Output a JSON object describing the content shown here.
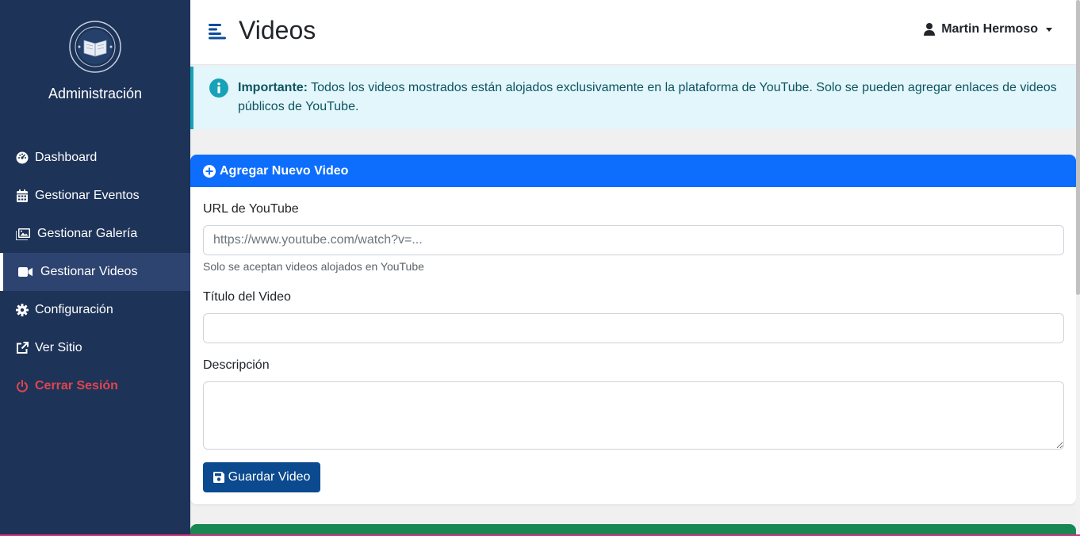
{
  "sidebar": {
    "brand": "Administración",
    "items": [
      {
        "label": "Dashboard",
        "icon": "dashboard-icon"
      },
      {
        "label": "Gestionar Eventos",
        "icon": "calendar-icon"
      },
      {
        "label": "Gestionar Galería",
        "icon": "image-icon"
      },
      {
        "label": "Gestionar Videos",
        "icon": "video-camera-icon",
        "active": true
      },
      {
        "label": "Configuración",
        "icon": "gear-icon"
      },
      {
        "label": "Ver Sitio",
        "icon": "external-link-icon"
      },
      {
        "label": "Cerrar Sesión",
        "icon": "power-icon",
        "color": "#e0454f"
      }
    ]
  },
  "header": {
    "title": "Videos",
    "user_name": "Martin Hermoso"
  },
  "alert": {
    "strong": "Importante:",
    "text": " Todos los videos mostrados están alojados exclusivamente en la plataforma de YouTube. Solo se pueden agregar enlaces de videos públicos de YouTube."
  },
  "form": {
    "title": "Agregar Nuevo Video",
    "url_label": "URL de YouTube",
    "url_placeholder": "https://www.youtube.com/watch?v=...",
    "url_help": "Solo se aceptan videos alojados en YouTube",
    "title_label": "Título del Video",
    "description_label": "Descripción",
    "save_label": "Guardar Video"
  },
  "colors": {
    "sidebar_bg": "#1d3358",
    "primary": "#0d6efd",
    "save_button": "#0b4a8f",
    "info": "#17a2b8",
    "success": "#198754",
    "danger": "#e0454f"
  }
}
